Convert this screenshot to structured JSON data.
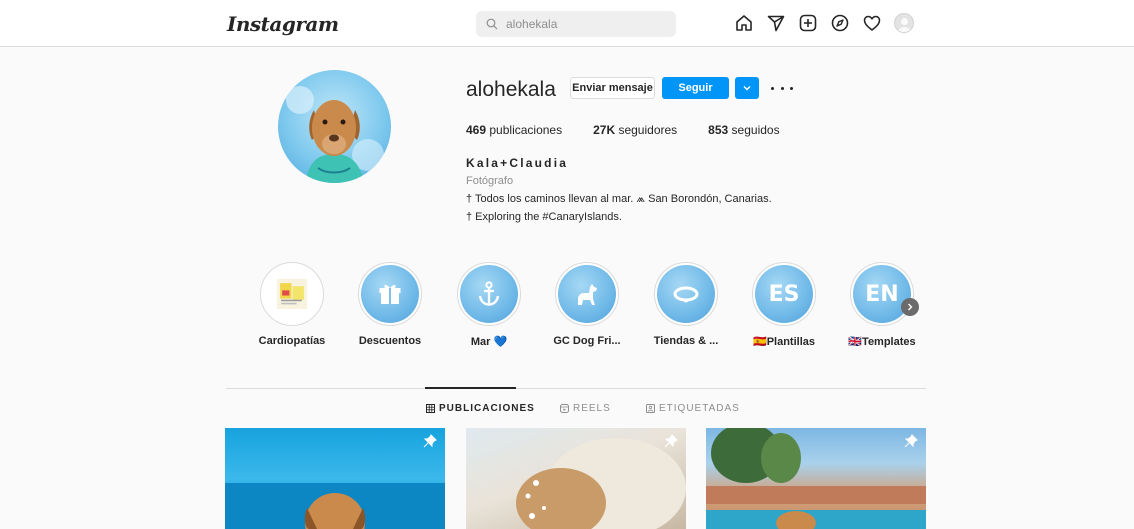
{
  "nav": {
    "logo": "Instagram",
    "search_value": "alohekala",
    "icons": [
      "home-icon",
      "direct-icon",
      "new-post-icon",
      "explore-icon",
      "activity-icon",
      "profile-avatar"
    ]
  },
  "profile": {
    "username": "alohekala",
    "message_button": "Enviar mensaje",
    "follow_button": "Seguir",
    "stats": {
      "posts_count": "469",
      "posts_label": "publicaciones",
      "followers_count": "27K",
      "followers_label": "seguidores",
      "following_count": "853",
      "following_label": "seguidos"
    },
    "full_name": "Kala+Claudia",
    "category": "Fotógrafo",
    "bio_line1": "† Todos los caminos llevan al mar. ⩕ San Borondón, Canarias.",
    "bio_line2": "† Exploring the #CanaryIslands."
  },
  "highlights": [
    {
      "label": "Cardiopatías"
    },
    {
      "label": "Descuentos"
    },
    {
      "label": "Mar 💙"
    },
    {
      "label": "GC Dog Fri..."
    },
    {
      "label": "Tiendas & ..."
    },
    {
      "label": "🇪🇸Plantillas",
      "badge": "ES"
    },
    {
      "label": "🇬🇧Templates",
      "badge": "EN"
    }
  ],
  "tabs": {
    "posts": "PUBLICACIONES",
    "reels": "REELS",
    "tagged": "ETIQUETADAS"
  },
  "colors": {
    "accent": "#0095f6",
    "text": "#262626",
    "muted": "#8e8e8e",
    "border": "#dbdbdb",
    "background": "#fafafa"
  }
}
